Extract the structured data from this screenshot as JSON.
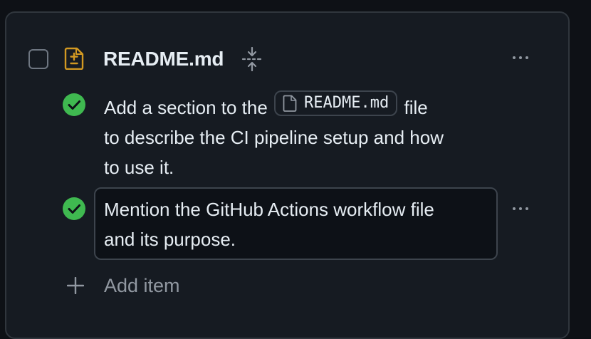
{
  "file": {
    "name": "README.md"
  },
  "items": [
    {
      "status": "completed",
      "text_before": "Add a section to the ",
      "chip_label": "README.md",
      "text_after": " file",
      "line2": "to describe the CI pipeline setup and how",
      "line3": "to use it."
    },
    {
      "status": "completed",
      "line1": "Mention the GitHub Actions workflow file",
      "line2": "and its purpose."
    }
  ],
  "add_item": {
    "label": "Add item"
  },
  "colors": {
    "background": "#0e1116",
    "panel": "#161b22",
    "border": "#30363d",
    "success": "#3fb950",
    "file_icon": "#d29922",
    "muted": "#9198a1"
  },
  "icons": {
    "file_diff": "file-diff-icon",
    "fold": "fold-icon",
    "check": "check-circle-icon",
    "file": "file-icon",
    "plus": "plus-icon",
    "more": "kebab-horizontal-icon"
  }
}
